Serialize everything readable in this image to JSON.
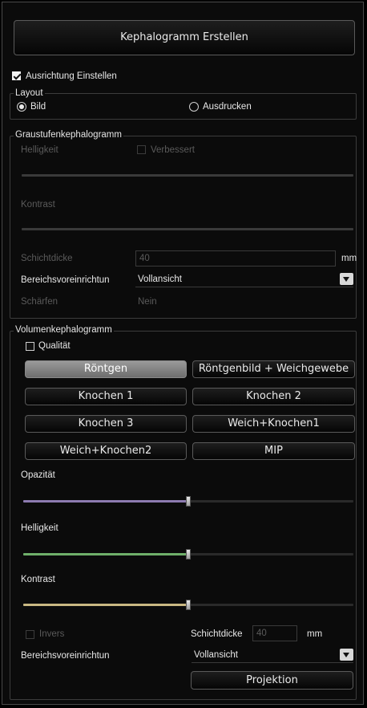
{
  "header": {
    "create_button": "Kephalogramm Erstellen"
  },
  "orientation": {
    "label": "Ausrichtung Einstellen",
    "checked": true
  },
  "layout": {
    "title": "Layout",
    "options": [
      {
        "label": "Bild",
        "selected": true
      },
      {
        "label": "Ausdrucken",
        "selected": false
      }
    ]
  },
  "grayscale": {
    "title": "Graustufenkephalogramm",
    "brightness_label": "Helligkeit",
    "improved_label": "Verbessert",
    "contrast_label": "Kontrast",
    "slice_label": "Schichtdicke",
    "slice_value": "40",
    "slice_unit": "mm",
    "range_label": "Bereichsvoreinrichtun",
    "range_value": "Vollansicht",
    "sharpen_label": "Schärfen",
    "sharpen_value": "Nein"
  },
  "volume": {
    "title": "Volumenkephalogramm",
    "quality_label": "Qualität",
    "quality_checked": false,
    "presets": [
      {
        "label": "Röntgen",
        "active": true
      },
      {
        "label": "Röntgenbild + Weichgewebe",
        "active": false
      },
      {
        "label": "Knochen 1",
        "active": false
      },
      {
        "label": "Knochen 2",
        "active": false
      },
      {
        "label": "Knochen 3",
        "active": false
      },
      {
        "label": "Weich+Knochen1",
        "active": false
      },
      {
        "label": "Weich+Knochen2",
        "active": false
      },
      {
        "label": "MIP",
        "active": false
      }
    ],
    "opacity_label": "Opazität",
    "opacity_value": 0.5,
    "opacity_color": "#8d7bb0",
    "brightness_label": "Helligkeit",
    "brightness_value": 0.5,
    "brightness_color": "#6fb06a",
    "contrast_label": "Kontrast",
    "contrast_value": 0.5,
    "contrast_color": "#c9b882",
    "invert_label": "Invers",
    "slice_label": "Schichtdicke",
    "slice_value": "40",
    "slice_unit": "mm",
    "range_label": "Bereichsvoreinrichtun",
    "range_value": "Vollansicht",
    "projection_button": "Projektion"
  }
}
